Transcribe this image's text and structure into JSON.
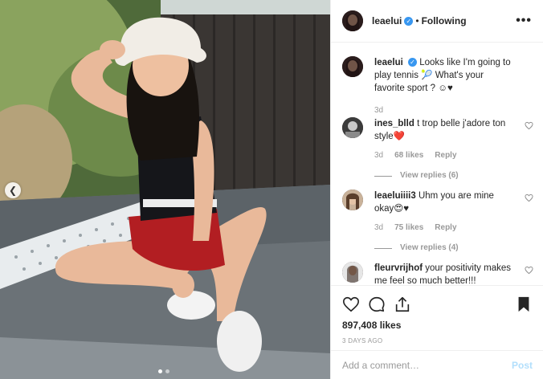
{
  "post": {
    "username": "leaelui",
    "follow_status": "Following",
    "separator": "•",
    "more_label": "•••",
    "caption": "Looks like I'm going to play tennis 🎾 What's your favorite sport ? ☺♥",
    "caption_age": "3d"
  },
  "comments": [
    {
      "username": "ines_blld",
      "text": "t trop belle j'adore ton style❤️",
      "age": "3d",
      "likes": "68 likes",
      "reply_label": "Reply",
      "view_replies": "View replies (6)"
    },
    {
      "username": "leaeluiiii3",
      "text": "Uhm you are mine okay😍♥",
      "age": "3d",
      "likes": "75 likes",
      "reply_label": "Reply",
      "view_replies": "View replies (4)"
    },
    {
      "username": "fleurvrijhof",
      "text": "your positivity makes me feel so much better!!!"
    }
  ],
  "stats": {
    "likes": "897,408 likes",
    "posted": "3 DAYS AGO"
  },
  "composer": {
    "placeholder": "Add a comment…",
    "post_label": "Post"
  },
  "icons": {
    "verified": "verified-badge-icon",
    "prev": "chevron-left-icon",
    "like": "heart-outline-icon",
    "comment": "comment-bubble-icon",
    "share": "share-upload-icon",
    "save": "bookmark-filled-icon"
  },
  "carousel": {
    "slides": 2,
    "active": 1
  },
  "colors": {
    "accent": "#3897f0",
    "post_disabled": "#b2dffc",
    "muted": "#999999",
    "text": "#262626"
  }
}
